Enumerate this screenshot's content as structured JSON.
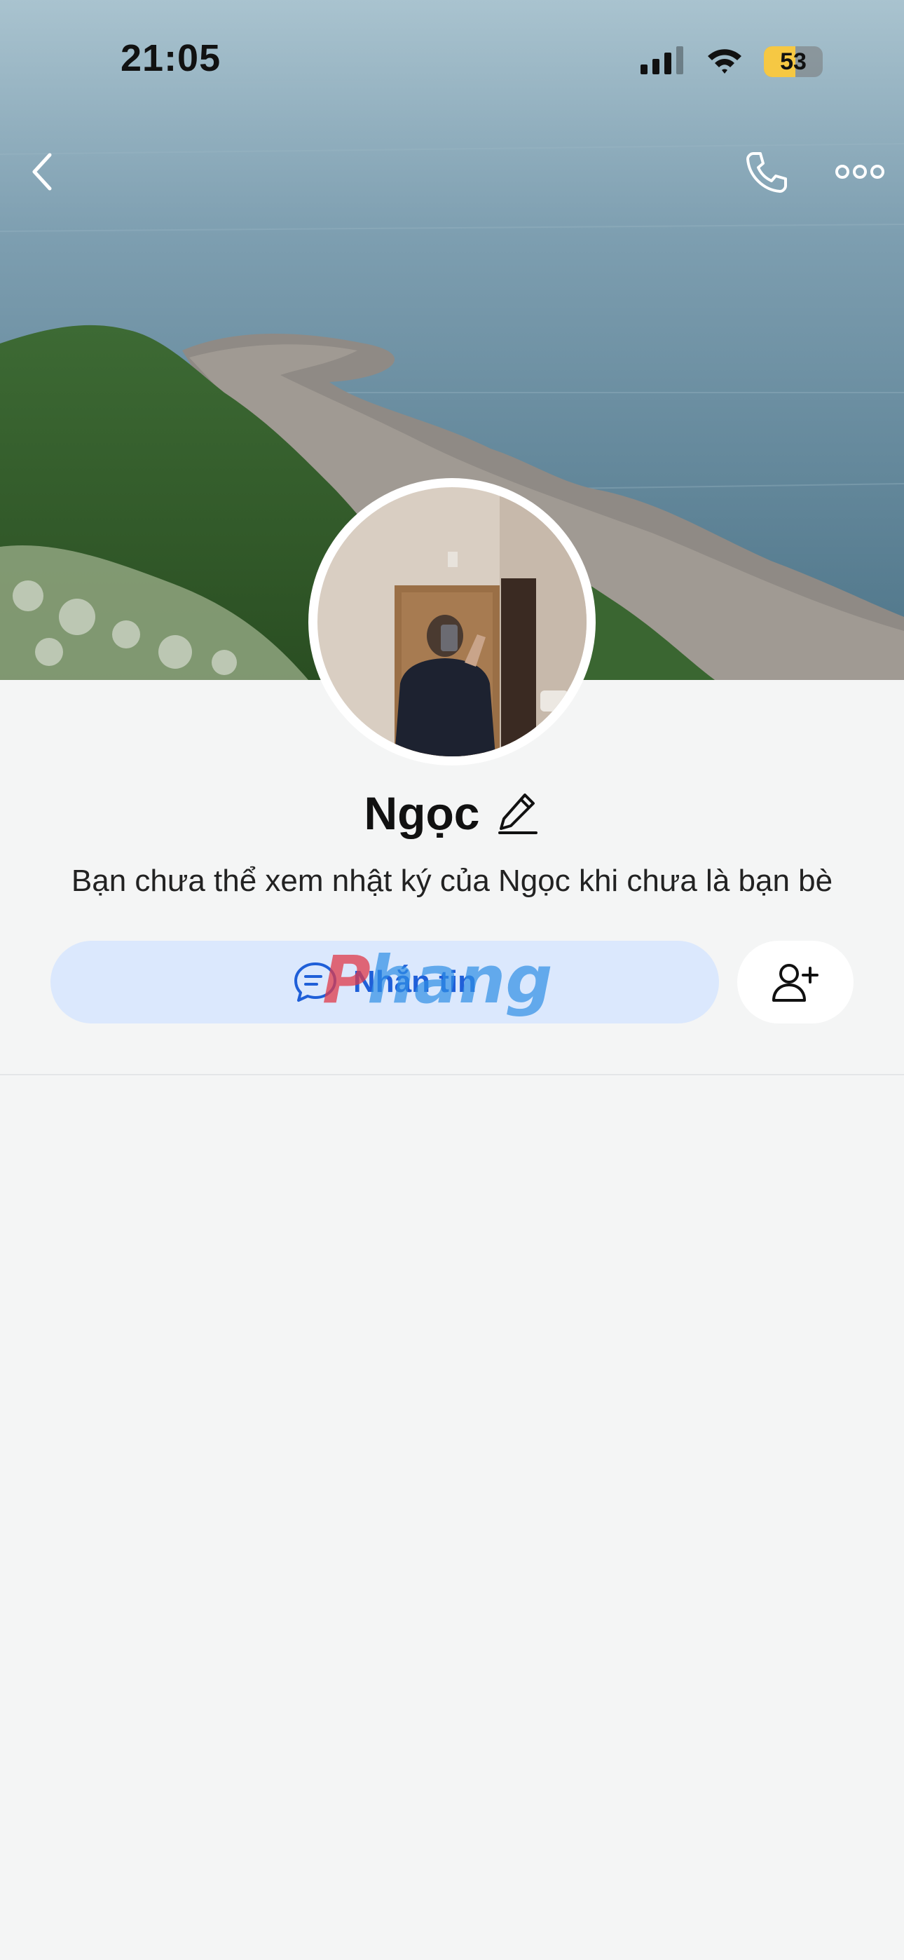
{
  "status_bar": {
    "time": "21:05",
    "battery_level": "53",
    "icons": [
      "cellular-signal-icon",
      "wifi-icon",
      "battery-icon"
    ]
  },
  "nav": {
    "icons": [
      "back-chevron-icon",
      "phone-icon",
      "more-dots-icon"
    ]
  },
  "profile": {
    "name": "Ngọc",
    "privacy_note": "Bạn chưa thể xem nhật ký của Ngọc khi chưa là bạn bè"
  },
  "actions": {
    "message_label": "Nhắn tin",
    "message_icon": "chat-bubble-icon",
    "add_friend_icon": "add-user-icon"
  },
  "watermark": {
    "text": "Phang"
  },
  "colors": {
    "background": "#f4f5f5",
    "message_button_bg": "#dbe8fd",
    "message_button_text": "#1f5fd8",
    "battery_fill": "#f6c843",
    "watermark_red": "#e03a4a",
    "watermark_blue": "#2f8fe6"
  }
}
